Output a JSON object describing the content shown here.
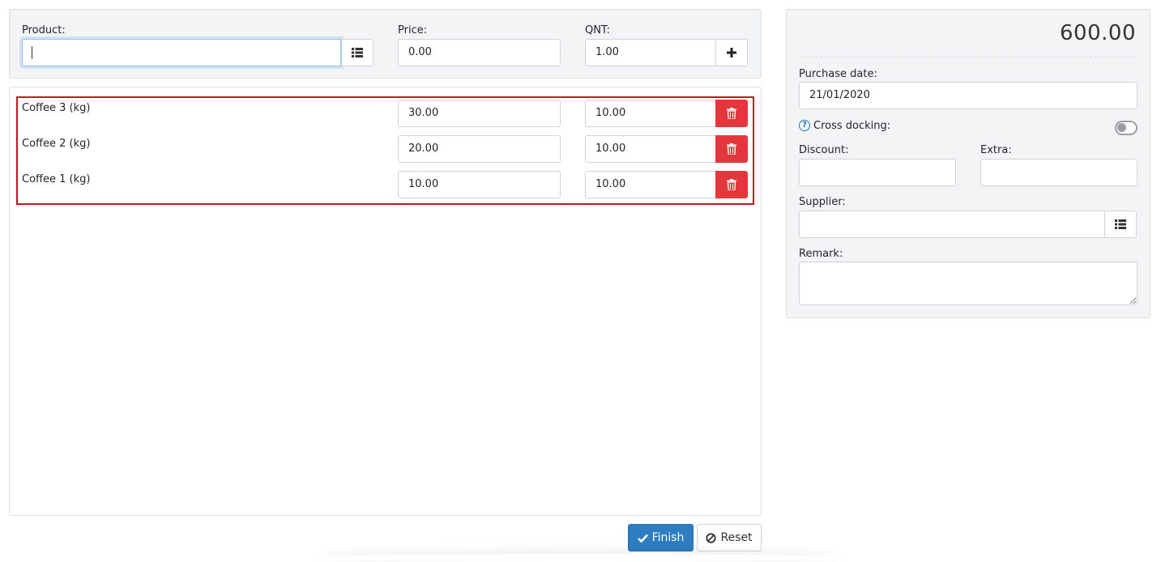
{
  "entry": {
    "product_label": "Product:",
    "product_value": "",
    "price_label": "Price:",
    "price_value": "0.00",
    "qnt_label": "QNT:",
    "qnt_value": "1.00"
  },
  "items": [
    {
      "name": "Coffee 3 (kg)",
      "price": "30.00",
      "qnt": "10.00"
    },
    {
      "name": "Coffee 2 (kg)",
      "price": "20.00",
      "qnt": "10.00"
    },
    {
      "name": "Coffee 1 (kg)",
      "price": "10.00",
      "qnt": "10.00"
    }
  ],
  "summary": {
    "total": "600.00",
    "purchase_date_label": "Purchase date:",
    "purchase_date_value": "21/01/2020",
    "cross_docking_label": "Cross docking:",
    "discount_label": "Discount:",
    "discount_value": "",
    "extra_label": "Extra:",
    "extra_value": "",
    "supplier_label": "Supplier:",
    "supplier_value": "",
    "remark_label": "Remark:",
    "remark_value": ""
  },
  "actions": {
    "finish_label": "Finish",
    "reset_label": "Reset"
  },
  "colors": {
    "danger": "#e4363d",
    "primary": "#2f7dc1",
    "highlight_border": "#c0181f",
    "panel_bg": "#f3f4f6"
  }
}
